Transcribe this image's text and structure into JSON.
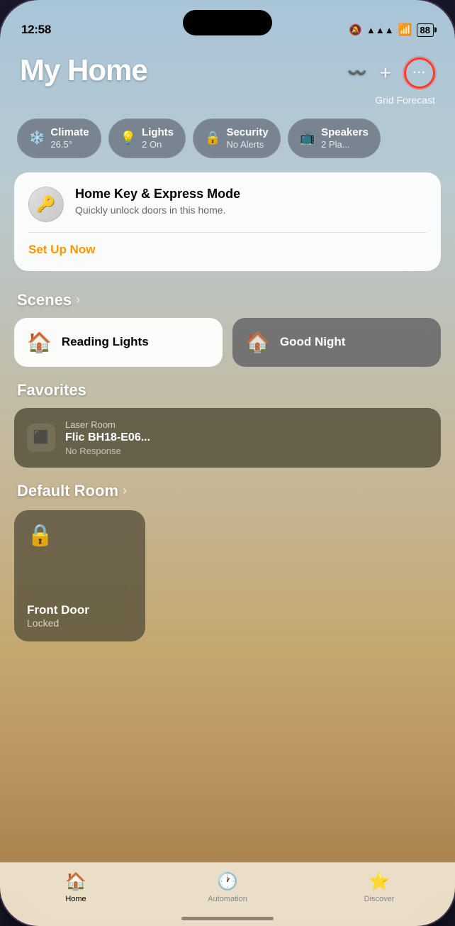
{
  "statusBar": {
    "time": "12:58",
    "bellIcon": "🔕",
    "signalBars": "▲▲▲",
    "wifi": "WiFi",
    "battery": "88"
  },
  "header": {
    "title": "My Home",
    "addIcon": "+",
    "waveIcon": "waveform",
    "moreIcon": "···",
    "gridForecast": "Grid Forecast"
  },
  "categories": [
    {
      "id": "climate",
      "icon": "❄️",
      "label": "Climate",
      "value": "26.5°"
    },
    {
      "id": "lights",
      "icon": "💡",
      "label": "Lights",
      "value": "2 On"
    },
    {
      "id": "security",
      "icon": "🔒",
      "label": "Security",
      "value": "No Alerts"
    },
    {
      "id": "speakers",
      "icon": "📺",
      "label": "Speakers",
      "value": "2 Pla..."
    }
  ],
  "homeKey": {
    "title": "Home Key & Express Mode",
    "subtitle": "Quickly unlock doors in this home.",
    "actionLabel": "Set Up Now"
  },
  "scenes": {
    "sectionTitle": "Scenes",
    "chevron": ">",
    "items": [
      {
        "id": "reading-lights",
        "label": "Reading Lights",
        "active": true
      },
      {
        "id": "good-night",
        "label": "Good Night",
        "active": false
      }
    ]
  },
  "favorites": {
    "sectionTitle": "Favorites",
    "devices": [
      {
        "id": "flic",
        "room": "Laser Room",
        "name": "Flic BH18-E06...",
        "status": "No Response"
      }
    ]
  },
  "defaultRoom": {
    "sectionTitle": "Default Room",
    "chevron": ">",
    "devices": [
      {
        "id": "front-door",
        "name": "Front Door",
        "status": "Locked"
      }
    ]
  },
  "tabBar": {
    "tabs": [
      {
        "id": "home",
        "label": "Home",
        "active": true
      },
      {
        "id": "automation",
        "label": "Automation",
        "active": false
      },
      {
        "id": "discover",
        "label": "Discover",
        "active": false
      }
    ]
  }
}
